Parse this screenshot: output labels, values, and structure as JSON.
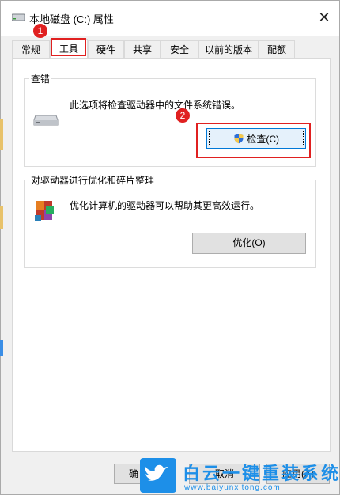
{
  "window": {
    "title": "本地磁盘 (C:) 属性",
    "close_glyph": "✕"
  },
  "tabs": [
    {
      "label": "常规"
    },
    {
      "label": "工具"
    },
    {
      "label": "硬件"
    },
    {
      "label": "共享"
    },
    {
      "label": "安全"
    },
    {
      "label": "以前的版本"
    },
    {
      "label": "配额"
    }
  ],
  "active_tab": "工具",
  "error_check": {
    "group_title": "查错",
    "description": "此选项将检查驱动器中的文件系统错误。",
    "button_label": "检查(C)"
  },
  "optimize": {
    "group_title": "对驱动器进行优化和碎片整理",
    "description": "优化计算机的驱动器可以帮助其更高效运行。",
    "button_label": "优化(O)"
  },
  "footer": {
    "ok_label": "确",
    "cancel_label": "取消",
    "apply_label": "应用(A)"
  },
  "annotations": {
    "step1": "1",
    "step2": "2"
  },
  "watermark": {
    "brand": "白云一键重装系统",
    "url": "www.baiyunxitong.com"
  },
  "colors": {
    "highlight": "#e02020",
    "accent": "#0078d7",
    "watermark": "#1d8fe8"
  }
}
